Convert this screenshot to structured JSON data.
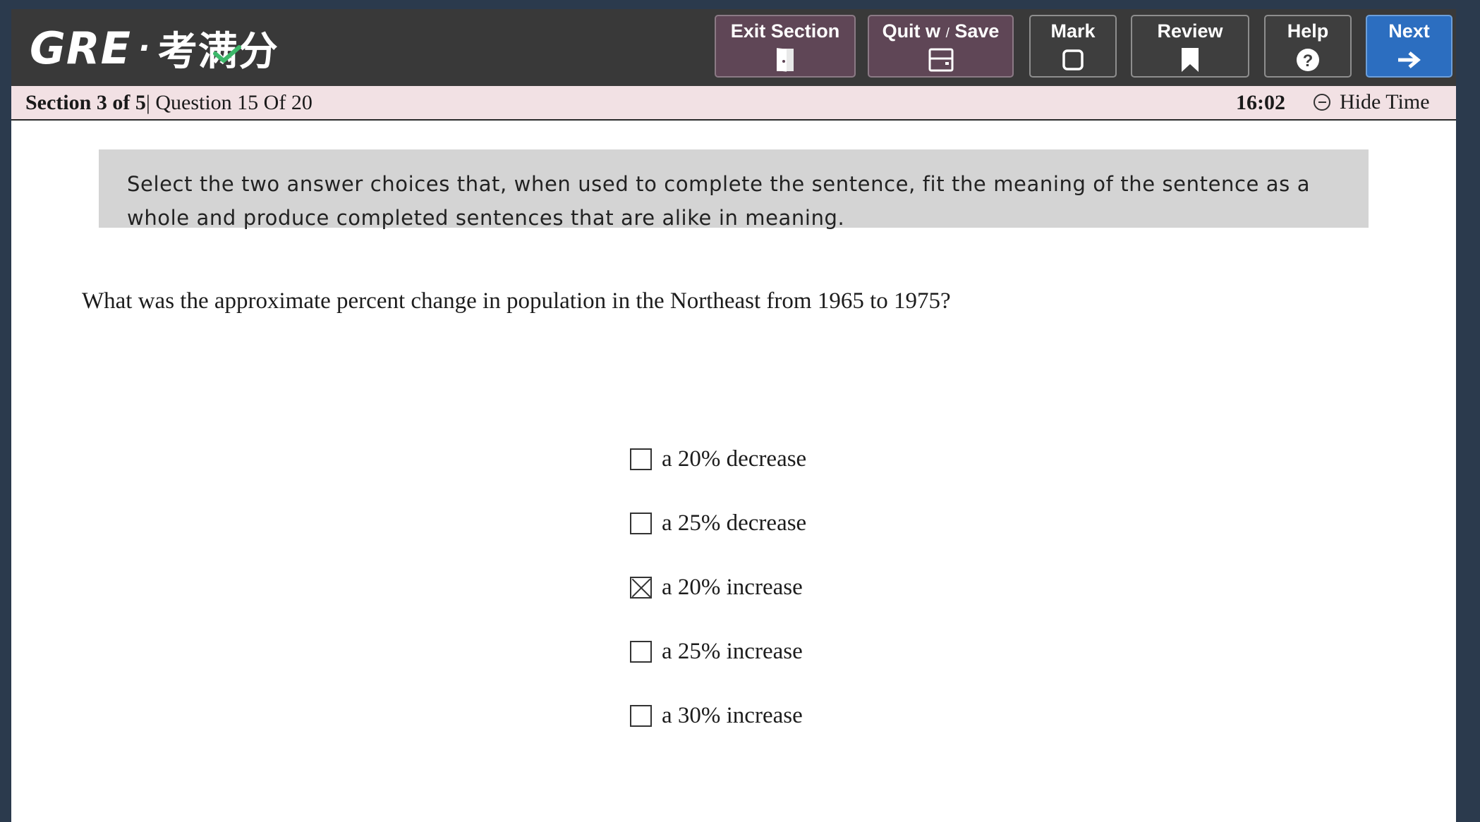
{
  "header": {
    "logo_text": "GRE",
    "logo_dot": "·",
    "logo_cn": "考满分",
    "buttons": {
      "exit_section": "Exit Section",
      "quit_save": "Quit w",
      "quit_save_sep": "/",
      "quit_save_tail": "Save",
      "mark": "Mark",
      "review": "Review",
      "help": "Help",
      "next": "Next"
    }
  },
  "status": {
    "section": "Section 3 of 5",
    "separator": "|",
    "question": " Question 15 Of 20",
    "time": "16:02",
    "hide_time": "Hide Time"
  },
  "instructions": "Select the two answer choices that, when used to complete the sentence, fit the meaning of the sentence as a whole and produce completed sentences that are alike in meaning.",
  "question": "What was the approximate percent change in population in the Northeast from 1965 to 1975?",
  "choices": [
    {
      "label": "a 20% decrease",
      "checked": false
    },
    {
      "label": "a 25% decrease",
      "checked": false
    },
    {
      "label": "a 20% increase",
      "checked": true
    },
    {
      "label": "a 25% increase",
      "checked": false
    },
    {
      "label": "a 30% increase",
      "checked": false
    }
  ],
  "colors": {
    "topbar": "#393939",
    "button_maroon": "#5f4656",
    "button_dark": "#3e3e3e",
    "button_blue": "#2c6ec0",
    "statusbar": "#f2e1e4",
    "instructions_bg": "#d4d4d4",
    "logo_check": "#3db86a"
  }
}
